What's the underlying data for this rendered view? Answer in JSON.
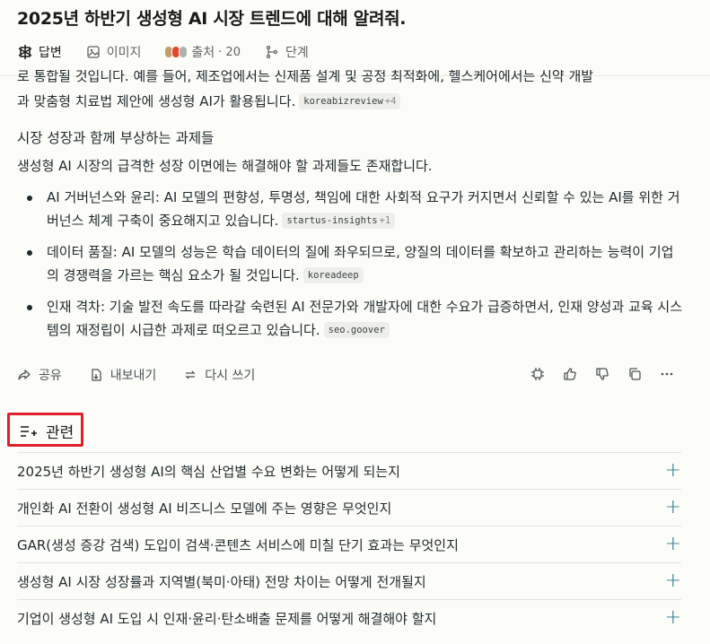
{
  "query": {
    "title": "2025년 하반기 생성형 AI 시장 트렌드에 대해 알려줘."
  },
  "tabs": [
    {
      "label": "답변",
      "icon": "answer-icon",
      "active": true
    },
    {
      "label": "이미지",
      "icon": "image-icon"
    },
    {
      "label": "출처",
      "icon": "sources-icon",
      "count": "· 20"
    },
    {
      "label": "단계",
      "icon": "steps-icon"
    }
  ],
  "answer": {
    "cut_line": "로 통합될 것입니다. 예를 들어, 제조업에서는 신제품 설계 및 공정 최적화에, 헬스케어에서는 신약 개발",
    "p1_text": "과 맞춤형 치료법 제안에 생성형 AI가 활용됩니다.",
    "p1_chip": {
      "source": "koreabizreview",
      "extra": "+4"
    },
    "heading": "시장 성장과 함께 부상하는 과제들",
    "intro": "생성형 AI 시장의 급격한 성장 이면에는 해결해야 할 과제들도 존재합니다.",
    "bullets": [
      {
        "text": "AI 거버넌스와 윤리: AI 모델의 편향성, 투명성, 책임에 대한 사회적 요구가 커지면서 신뢰할 수 있는 AI를 위한 거버넌스 체계 구축이 중요해지고 있습니다.",
        "chip": "startus-insights",
        "extra": "+1"
      },
      {
        "text": "데이터 품질: AI 모델의 성능은 학습 데이터의 질에 좌우되므로, 양질의 데이터를 확보하고 관리하는 능력이 기업의 경쟁력을 가르는 핵심 요소가 될 것입니다.",
        "chip": "koreadeep",
        "extra": ""
      },
      {
        "text": "인재 격차: 기술 발전 속도를 따라갈 숙련된 AI 전문가와 개발자에 대한 수요가 급증하면서, 인재 양성과 교육 시스템의 재정립이 시급한 과제로 떠오르고 있습니다.",
        "chip": "seo.goover",
        "extra": ""
      }
    ]
  },
  "actions": {
    "share": "공유",
    "export": "내보내기",
    "rewrite": "다시 쓰기"
  },
  "related": {
    "title": "관련",
    "items": [
      "2025년 하반기 생성형 AI의 핵심 산업별 수요 변화는 어떻게 되는지",
      "개인화 AI 전환이 생성형 AI 비즈니스 모델에 주는 영향은 무엇인지",
      "GAR(생성 증강 검색) 도입이 검색·콘텐츠 서비스에 미칠 단기 효과는 무엇인지",
      "생성형 AI 시장 성장률과 지역별(북미·아태) 전망 차이는 어떻게 전개될지",
      "기업이 생성형 AI 도입 시 인재·윤리·탄소배출 문제를 어떻게 해결해야 할지"
    ]
  },
  "colors": {
    "accent": "#2b7c8c",
    "highlight_box": "#e0202a"
  }
}
